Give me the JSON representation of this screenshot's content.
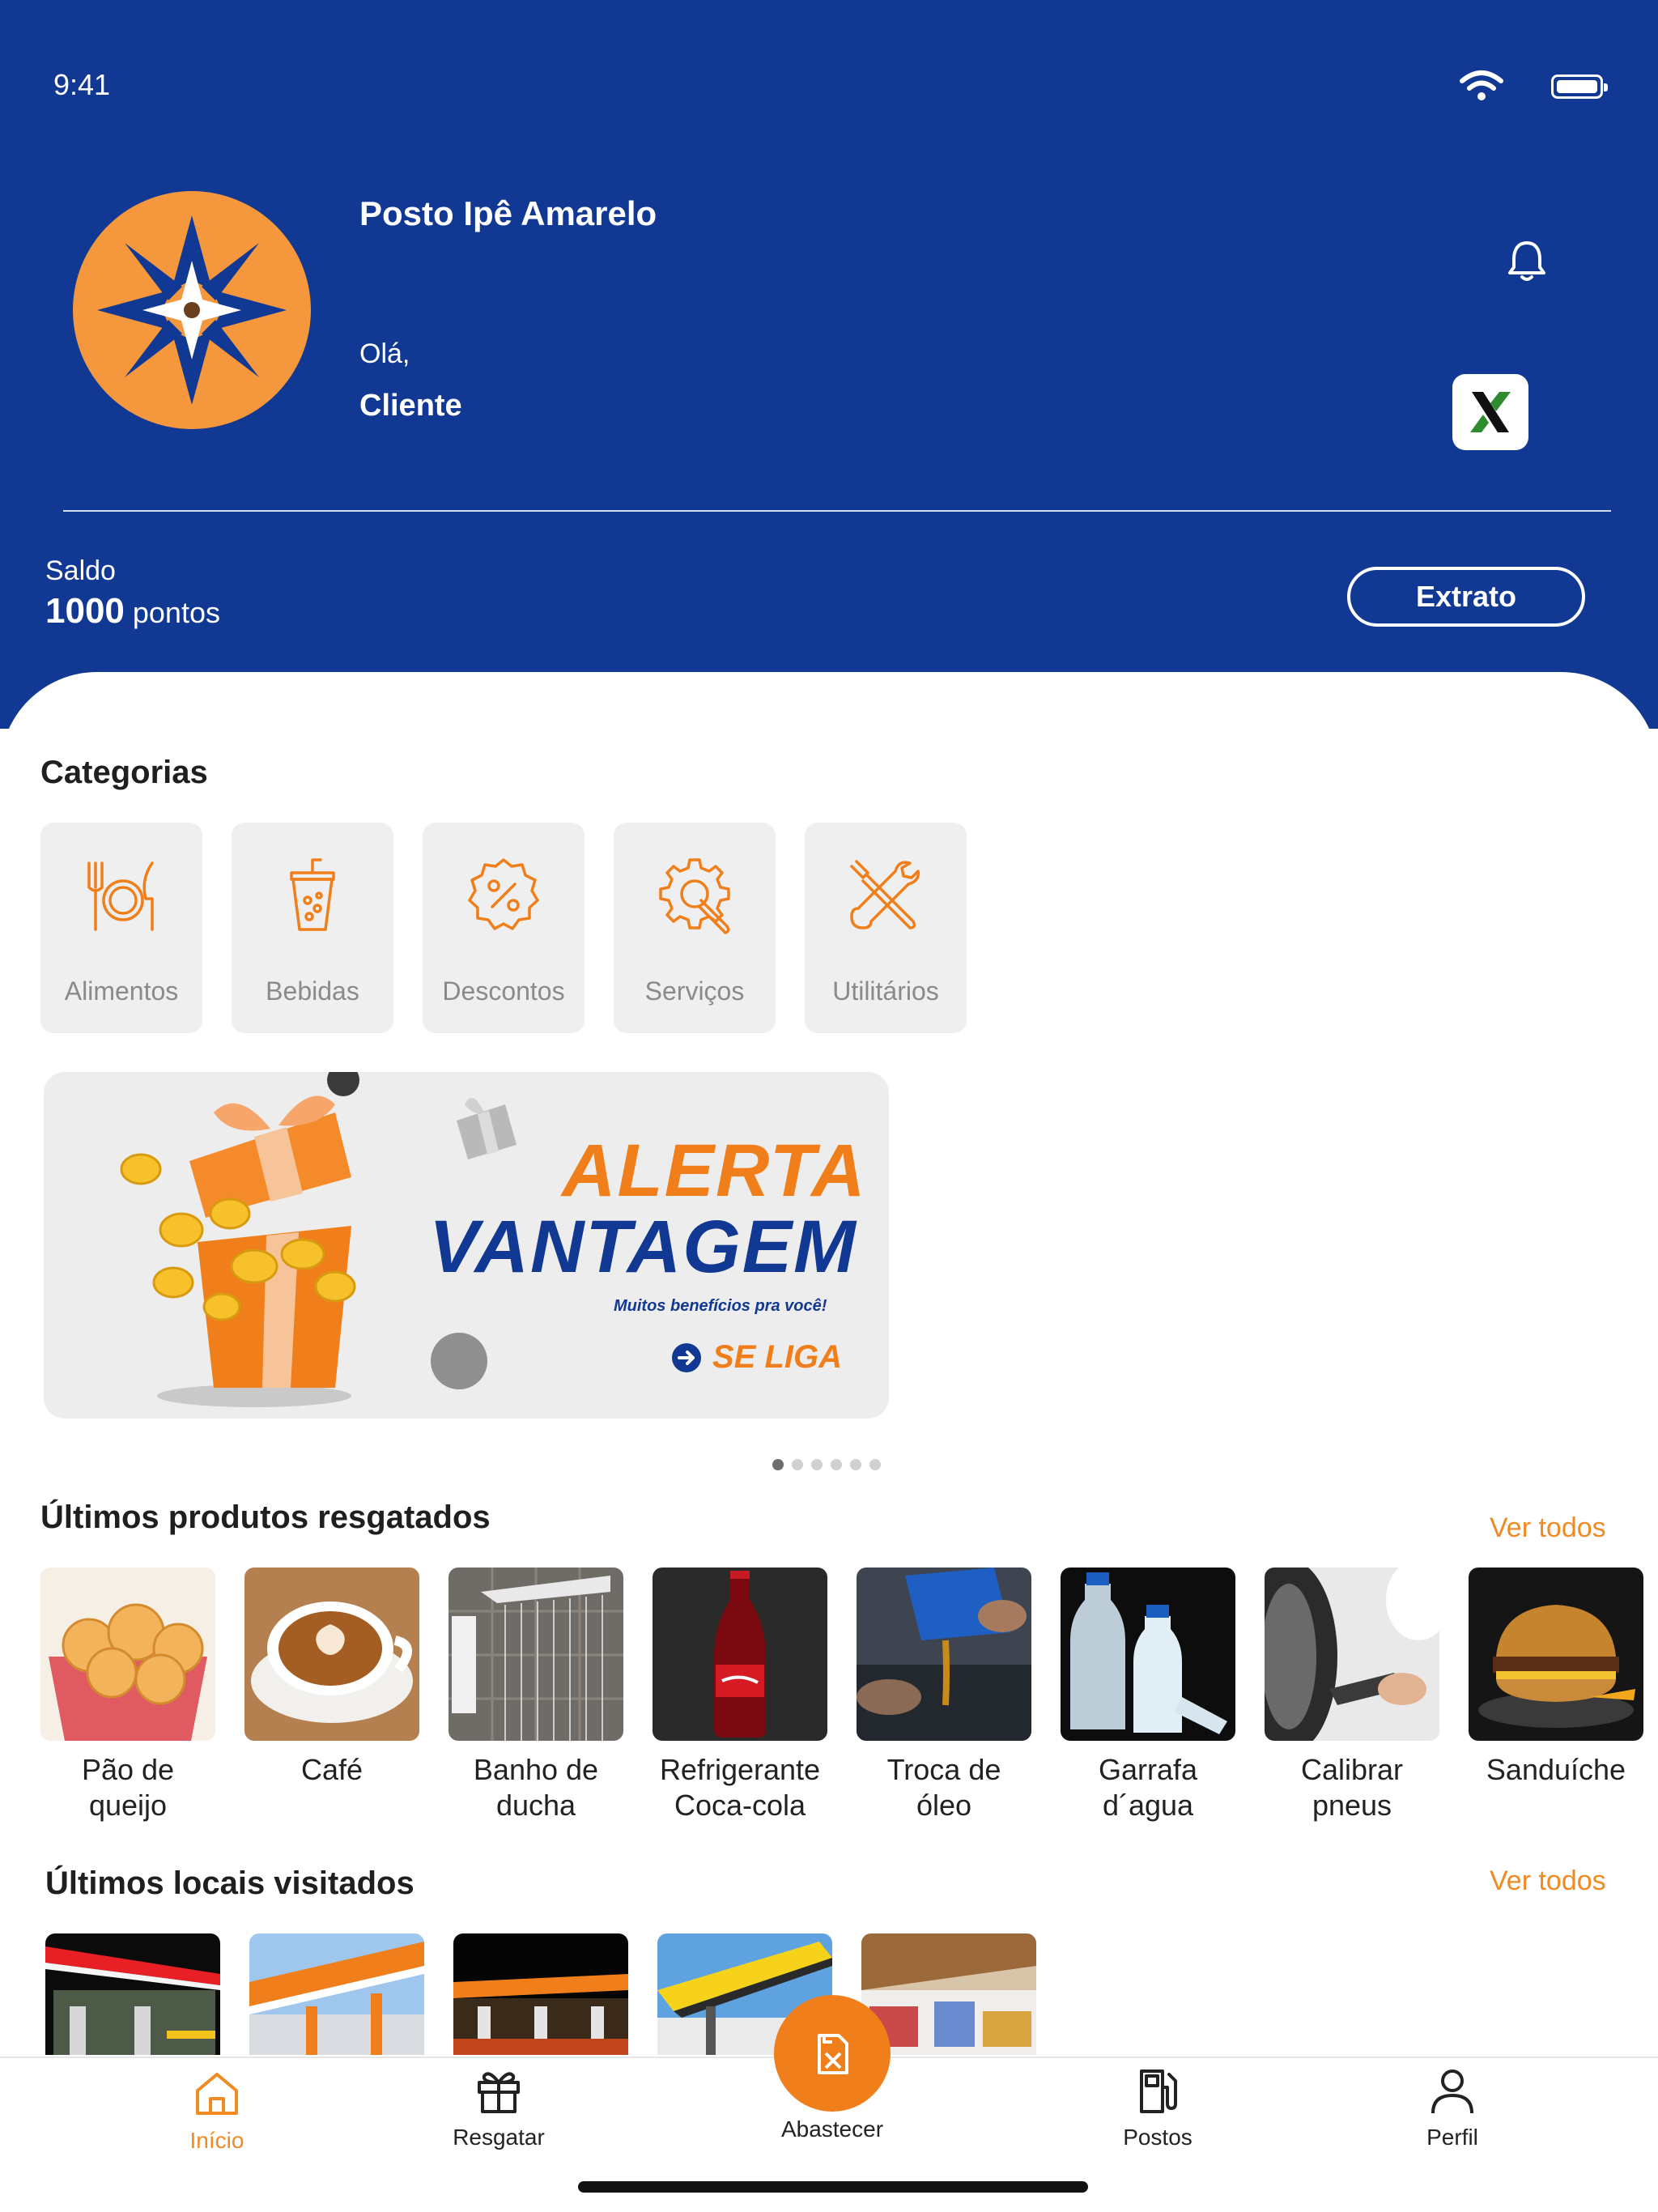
{
  "status_bar": {
    "time": "9:41"
  },
  "header": {
    "station_name": "Posto Ipê Amarelo",
    "greeting": "Olá,",
    "user_name": "Cliente",
    "balance_label": "Saldo",
    "balance_value": "1000",
    "balance_unit": "pontos",
    "statement_button": "Extrato"
  },
  "categories": {
    "title": "Categorias",
    "items": [
      {
        "label": "Alimentos",
        "icon": "utensils-icon"
      },
      {
        "label": "Bebidas",
        "icon": "drink-cup-icon"
      },
      {
        "label": "Descontos",
        "icon": "discount-badge-icon"
      },
      {
        "label": "Serviços",
        "icon": "gear-wrench-icon"
      },
      {
        "label": "Utilitários",
        "icon": "tools-icon"
      }
    ]
  },
  "banner": {
    "title_line1": "ALERTA",
    "title_line2": "VANTAGEM",
    "subtitle": "Muitos benefícios pra você!",
    "cta": "SE LIGA",
    "page_count": 6,
    "active_page": 1
  },
  "recent_products": {
    "title": "Últimos produtos resgatados",
    "see_all": "Ver todos",
    "items": [
      {
        "name": "Pão de\nqueijo"
      },
      {
        "name": "Café"
      },
      {
        "name": "Banho de\nducha"
      },
      {
        "name": "Refrigerante\nCoca-cola"
      },
      {
        "name": "Troca de\nóleo"
      },
      {
        "name": "Garrafa\nd´agua"
      },
      {
        "name": "Calibrar\npneus"
      },
      {
        "name": "Sanduíche"
      }
    ]
  },
  "recent_places": {
    "title": "Últimos locais visitados",
    "see_all": "Ver todos"
  },
  "tabbar": {
    "home": "Início",
    "redeem": "Resgatar",
    "refuel": "Abastecer",
    "stations": "Postos",
    "profile": "Perfil"
  },
  "colors": {
    "primary_blue": "#113892",
    "accent_orange": "#f07f1b"
  }
}
